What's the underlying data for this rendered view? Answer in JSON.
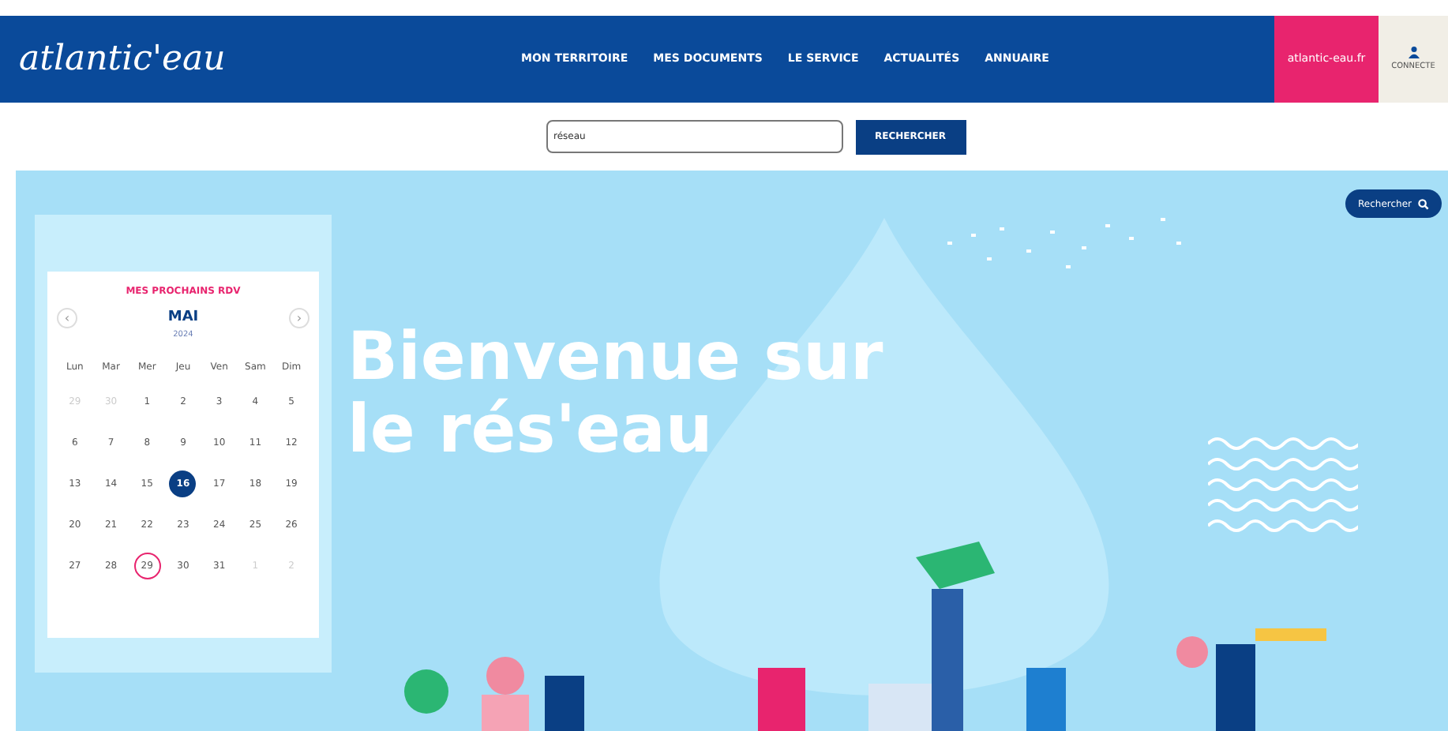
{
  "header": {
    "logo": "atlantic'eau",
    "nav": [
      {
        "label": "MON TERRITOIRE"
      },
      {
        "label": "MES DOCUMENTS"
      },
      {
        "label": "LE SERVICE"
      },
      {
        "label": "ACTUALITÉS"
      },
      {
        "label": "ANNUAIRE"
      }
    ],
    "site_link": "atlantic-eau.fr",
    "account": "CONNECTE"
  },
  "search": {
    "value": "réseau",
    "button": "RECHERCHER"
  },
  "hero": {
    "search_pill": "Rechercher",
    "title_lines": [
      "Bienvenue sur",
      "le rés'eau"
    ]
  },
  "calendar": {
    "title": "MES PROCHAINS RDV",
    "month": "MAI",
    "year": "2024",
    "prev": "‹",
    "next": "›",
    "weekdays": [
      "Lun",
      "Mar",
      "Mer",
      "Jeu",
      "Ven",
      "Sam",
      "Dim"
    ],
    "weeks": [
      [
        {
          "d": "29",
          "muted": true,
          "selected": false,
          "marked": false
        },
        {
          "d": "30",
          "muted": true,
          "selected": false,
          "marked": false
        },
        {
          "d": "1",
          "muted": false,
          "selected": false,
          "marked": false
        },
        {
          "d": "2",
          "muted": false,
          "selected": false,
          "marked": false
        },
        {
          "d": "3",
          "muted": false,
          "selected": false,
          "marked": false
        },
        {
          "d": "4",
          "muted": false,
          "selected": false,
          "marked": false
        },
        {
          "d": "5",
          "muted": false,
          "selected": false,
          "marked": false
        }
      ],
      [
        {
          "d": "6",
          "muted": false,
          "selected": false,
          "marked": false
        },
        {
          "d": "7",
          "muted": false,
          "selected": false,
          "marked": false
        },
        {
          "d": "8",
          "muted": false,
          "selected": false,
          "marked": false
        },
        {
          "d": "9",
          "muted": false,
          "selected": false,
          "marked": false
        },
        {
          "d": "10",
          "muted": false,
          "selected": false,
          "marked": false
        },
        {
          "d": "11",
          "muted": false,
          "selected": false,
          "marked": false
        },
        {
          "d": "12",
          "muted": false,
          "selected": false,
          "marked": false
        }
      ],
      [
        {
          "d": "13",
          "muted": false,
          "selected": false,
          "marked": false
        },
        {
          "d": "14",
          "muted": false,
          "selected": false,
          "marked": false
        },
        {
          "d": "15",
          "muted": false,
          "selected": false,
          "marked": false
        },
        {
          "d": "16",
          "muted": false,
          "selected": true,
          "marked": false
        },
        {
          "d": "17",
          "muted": false,
          "selected": false,
          "marked": false
        },
        {
          "d": "18",
          "muted": false,
          "selected": false,
          "marked": false
        },
        {
          "d": "19",
          "muted": false,
          "selected": false,
          "marked": false
        }
      ],
      [
        {
          "d": "20",
          "muted": false,
          "selected": false,
          "marked": false
        },
        {
          "d": "21",
          "muted": false,
          "selected": false,
          "marked": false
        },
        {
          "d": "22",
          "muted": false,
          "selected": false,
          "marked": false
        },
        {
          "d": "23",
          "muted": false,
          "selected": false,
          "marked": false
        },
        {
          "d": "24",
          "muted": false,
          "selected": false,
          "marked": false
        },
        {
          "d": "25",
          "muted": false,
          "selected": false,
          "marked": false
        },
        {
          "d": "26",
          "muted": false,
          "selected": false,
          "marked": false
        }
      ],
      [
        {
          "d": "27",
          "muted": false,
          "selected": false,
          "marked": false
        },
        {
          "d": "28",
          "muted": false,
          "selected": false,
          "marked": false
        },
        {
          "d": "29",
          "muted": false,
          "selected": false,
          "marked": true
        },
        {
          "d": "30",
          "muted": false,
          "selected": false,
          "marked": false
        },
        {
          "d": "31",
          "muted": false,
          "selected": false,
          "marked": false
        },
        {
          "d": "1",
          "muted": true,
          "selected": false,
          "marked": false
        },
        {
          "d": "2",
          "muted": true,
          "selected": false,
          "marked": false
        }
      ]
    ]
  }
}
